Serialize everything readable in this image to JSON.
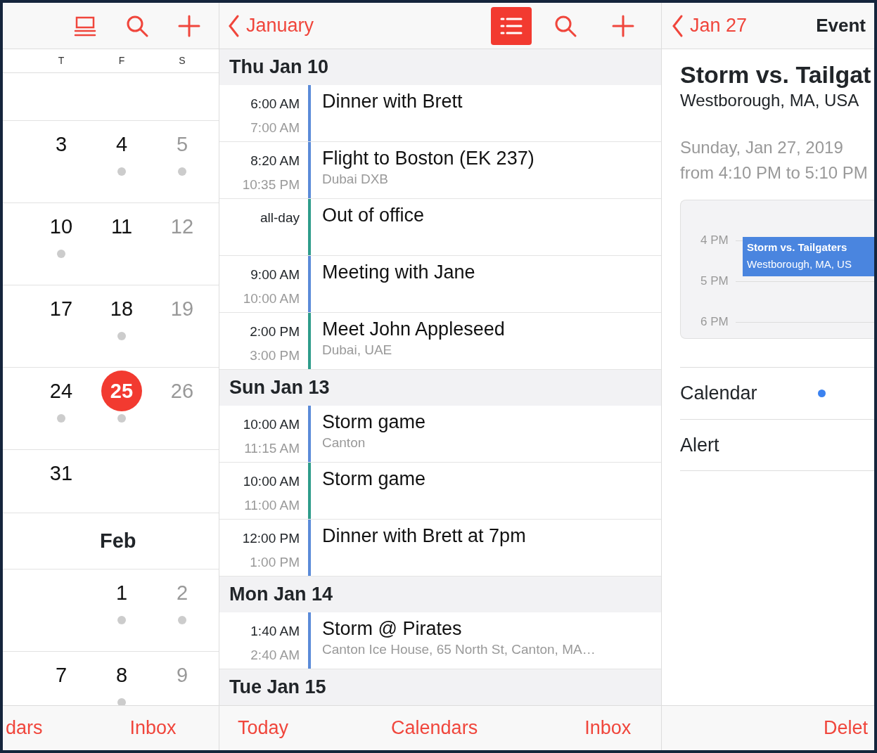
{
  "month_panel": {
    "weekdays": [
      "T",
      "F",
      "S"
    ],
    "weeks": [
      {
        "kind": "week",
        "cells": [
          null,
          null,
          null
        ]
      },
      {
        "kind": "week",
        "cells": [
          {
            "day": "3",
            "dot": false,
            "dimmed": false,
            "today": false
          },
          {
            "day": "4",
            "dot": true,
            "dimmed": false,
            "today": false
          },
          {
            "day": "5",
            "dot": true,
            "dimmed": true,
            "today": false
          }
        ]
      },
      {
        "kind": "week",
        "cells": [
          {
            "day": "10",
            "dot": true,
            "dimmed": false,
            "today": false
          },
          {
            "day": "11",
            "dot": false,
            "dimmed": false,
            "today": false
          },
          {
            "day": "12",
            "dot": false,
            "dimmed": true,
            "today": false
          }
        ]
      },
      {
        "kind": "week",
        "cells": [
          {
            "day": "17",
            "dot": false,
            "dimmed": false,
            "today": false
          },
          {
            "day": "18",
            "dot": true,
            "dimmed": false,
            "today": false
          },
          {
            "day": "19",
            "dot": false,
            "dimmed": true,
            "today": false
          }
        ]
      },
      {
        "kind": "week",
        "cells": [
          {
            "day": "24",
            "dot": true,
            "dimmed": false,
            "today": false
          },
          {
            "day": "25",
            "dot": true,
            "dimmed": false,
            "today": true
          },
          {
            "day": "26",
            "dot": false,
            "dimmed": true,
            "today": false
          }
        ]
      },
      {
        "kind": "week",
        "cells": [
          {
            "day": "31",
            "dot": false,
            "dimmed": false,
            "today": false
          },
          null,
          null
        ]
      },
      {
        "kind": "month_label",
        "label": "Feb"
      },
      {
        "kind": "week",
        "cells": [
          null,
          {
            "day": "1",
            "dot": true,
            "dimmed": false,
            "today": false
          },
          {
            "day": "2",
            "dot": true,
            "dimmed": true,
            "today": false
          }
        ]
      },
      {
        "kind": "week",
        "cells": [
          {
            "day": "7",
            "dot": false,
            "dimmed": false,
            "today": false
          },
          {
            "day": "8",
            "dot": true,
            "dimmed": false,
            "today": false
          },
          {
            "day": "9",
            "dot": false,
            "dimmed": true,
            "today": false
          }
        ]
      }
    ],
    "tab_bar": [
      "dars",
      "Inbox"
    ]
  },
  "list_panel": {
    "back": "January",
    "list_view_selected": true,
    "days": [
      {
        "header": "Thu  Jan 10",
        "events": [
          {
            "start": "6:00 AM",
            "end": "7:00 AM",
            "title": "Dinner with Brett",
            "color": "#5b8bd8"
          },
          {
            "start": "8:20 AM",
            "end": "10:35 PM",
            "title": "Flight to Boston (EK 237)",
            "location": "Dubai DXB",
            "color": "#5b8bd8"
          },
          {
            "start": "all-day",
            "title": "Out of office",
            "color": "#2f9c8b"
          },
          {
            "start": "9:00 AM",
            "end": "10:00 AM",
            "title": "Meeting with Jane",
            "color": "#5b8bd8"
          },
          {
            "start": "2:00 PM",
            "end": "3:00 PM",
            "title": "Meet John Appleseed",
            "location": "Dubai, UAE",
            "color": "#2f9c8b"
          }
        ]
      },
      {
        "header": "Sun  Jan 13",
        "events": [
          {
            "start": "10:00 AM",
            "end": "11:15 AM",
            "title": "Storm game",
            "location": "Canton",
            "color": "#5b8bd8"
          },
          {
            "start": "10:00 AM",
            "end": "11:00 AM",
            "title": "Storm game",
            "color": "#2f9c8b"
          },
          {
            "start": "12:00 PM",
            "end": "1:00 PM",
            "title": "Dinner with Brett at 7pm",
            "color": "#5b8bd8"
          }
        ]
      },
      {
        "header": "Mon  Jan 14",
        "events": [
          {
            "start": "1:40 AM",
            "end": "2:40 AM",
            "title": "Storm @ Pirates",
            "location": "Canton Ice House, 65 North St, Canton, MA…",
            "color": "#5b8bd8"
          }
        ]
      },
      {
        "header": "Tue  Jan 15"
      }
    ],
    "tab_bar": [
      "Today",
      "Calendars",
      "Inbox"
    ]
  },
  "detail_panel": {
    "back": "Jan 27",
    "title": "Event",
    "event_title": "Storm vs. Tailgat",
    "location": "Westborough, MA, USA",
    "date": "Sunday, Jan 27, 2019",
    "time": "from 4:10 PM to 5:10 PM",
    "timeline": {
      "hours": [
        "4 PM",
        "5 PM",
        "6 PM"
      ],
      "block_title": "Storm vs. Tailgaters",
      "block_location": "Westborough, MA, US"
    },
    "rows": [
      {
        "label": "Calendar",
        "color": "#3b82f0"
      },
      {
        "label": "Alert"
      }
    ],
    "tab_bar": [
      "Delet"
    ]
  }
}
